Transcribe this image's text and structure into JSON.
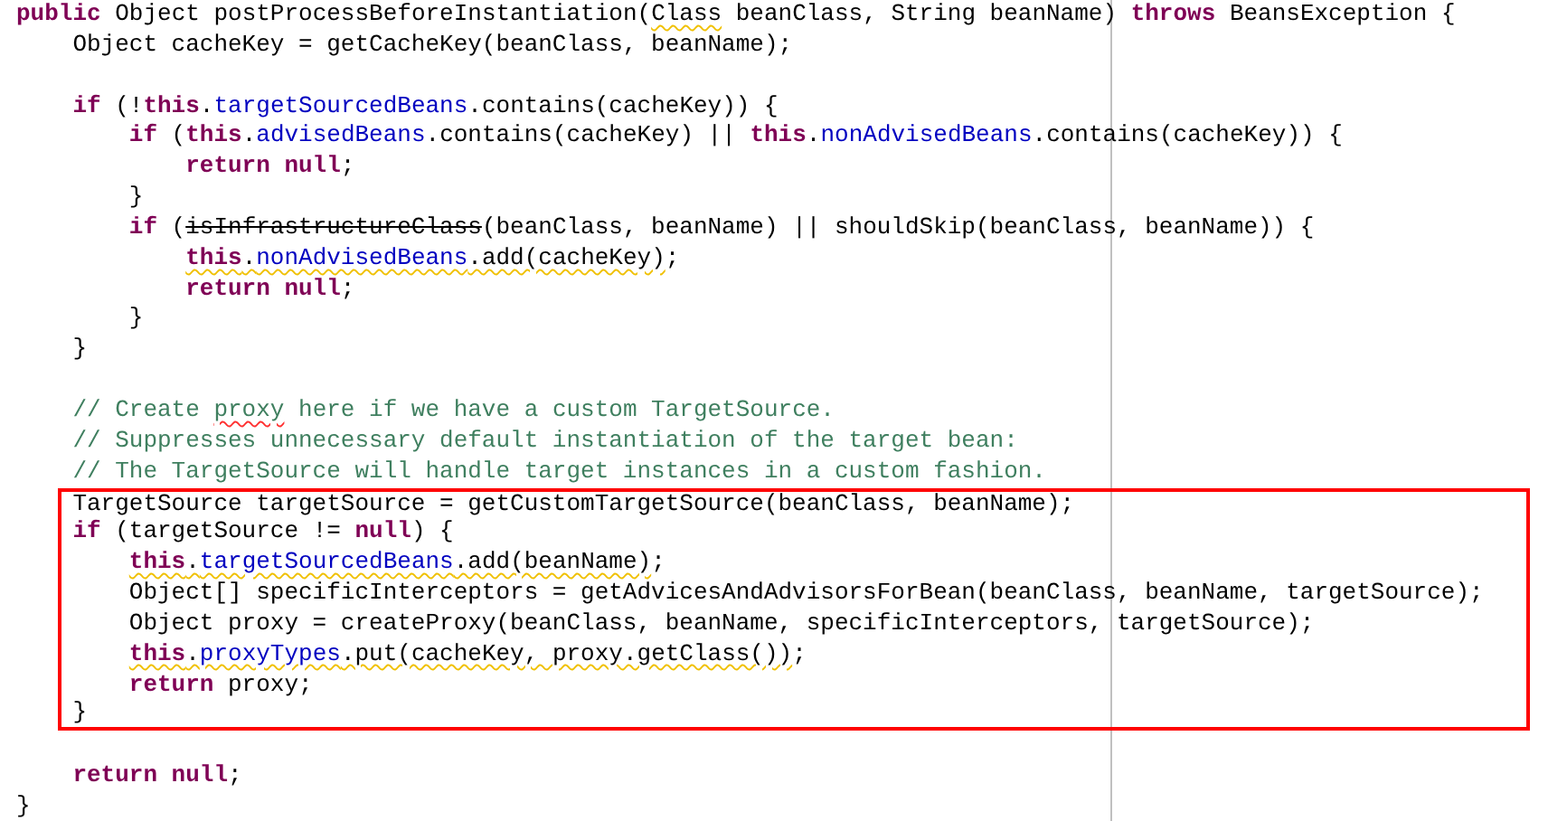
{
  "editor": {
    "lines": [
      {
        "highlighted": false,
        "segments": [
          {
            "text": "public",
            "kind": "keyword"
          },
          {
            "text": " Object postProcessBeforeInstantiation(",
            "kind": "plain"
          },
          {
            "text": "Class",
            "kind": "plain",
            "warning": true
          },
          {
            "text": " beanClass, String beanName) ",
            "kind": "plain"
          },
          {
            "text": "throws",
            "kind": "keyword"
          },
          {
            "text": " BeansException {",
            "kind": "plain"
          }
        ],
        "children": [
          {
            "highlighted": false,
            "segments": [
              {
                "text": "Object cacheKey = getCacheKey(beanClass, beanName);",
                "kind": "plain"
              }
            ]
          },
          {
            "highlighted": false
          },
          {
            "highlighted": false,
            "segments": [
              {
                "text": "if",
                "kind": "keyword"
              },
              {
                "text": " (!",
                "kind": "plain"
              },
              {
                "text": "this",
                "kind": "keyword"
              },
              {
                "text": ".",
                "kind": "plain"
              },
              {
                "text": "targetSourcedBeans",
                "kind": "field"
              },
              {
                "text": ".contains(cacheKey)) {",
                "kind": "plain"
              }
            ],
            "children": [
              {
                "highlighted": false,
                "segments": [
                  {
                    "text": "if",
                    "kind": "keyword"
                  },
                  {
                    "text": " (",
                    "kind": "plain"
                  },
                  {
                    "text": "this",
                    "kind": "keyword"
                  },
                  {
                    "text": ".",
                    "kind": "plain"
                  },
                  {
                    "text": "advisedBeans",
                    "kind": "field"
                  },
                  {
                    "text": ".contains(cacheKey) || ",
                    "kind": "plain"
                  },
                  {
                    "text": "this",
                    "kind": "keyword"
                  },
                  {
                    "text": ".",
                    "kind": "plain"
                  },
                  {
                    "text": "nonAdvisedBeans",
                    "kind": "field"
                  },
                  {
                    "text": ".contains(cacheKey)) {",
                    "kind": "plain"
                  }
                ],
                "children": [
                  {
                    "highlighted": false,
                    "segments": [
                      {
                        "text": "return null",
                        "kind": "keyword"
                      },
                      {
                        "text": ";",
                        "kind": "plain"
                      }
                    ]
                  }
                ]
              },
              {
                "highlighted": false,
                "segments": [
                  {
                    "text": "}",
                    "kind": "plain"
                  }
                ]
              },
              {
                "highlighted": false,
                "segments": [
                  {
                    "text": "if",
                    "kind": "keyword"
                  },
                  {
                    "text": " (",
                    "kind": "plain"
                  },
                  {
                    "text": "isInfrastructureClass",
                    "kind": "plain",
                    "deprecated": true
                  },
                  {
                    "text": "(beanClass, beanName) || shouldSkip(beanClass, beanName)) {",
                    "kind": "plain"
                  }
                ],
                "children": [
                  {
                    "highlighted": false,
                    "segments": [
                      {
                        "text": "this",
                        "kind": "keyword",
                        "warning": true
                      },
                      {
                        "text": ".",
                        "kind": "plain",
                        "warning": true
                      },
                      {
                        "text": "nonAdvisedBeans",
                        "kind": "field",
                        "warning": true
                      },
                      {
                        "text": ".add(cacheKey)",
                        "kind": "plain",
                        "warning": true
                      },
                      {
                        "text": ";",
                        "kind": "plain"
                      }
                    ]
                  },
                  {
                    "highlighted": false,
                    "segments": [
                      {
                        "text": "return null",
                        "kind": "keyword"
                      },
                      {
                        "text": ";",
                        "kind": "plain"
                      }
                    ]
                  }
                ]
              },
              {
                "highlighted": false,
                "segments": [
                  {
                    "text": "}",
                    "kind": "plain"
                  }
                ]
              }
            ]
          },
          {
            "highlighted": false,
            "segments": [
              {
                "text": "}",
                "kind": "plain"
              }
            ]
          },
          {
            "highlighted": false
          },
          {
            "highlighted": false,
            "segments": [
              {
                "text": "// Create ",
                "kind": "comment"
              },
              {
                "text": "proxy",
                "kind": "comment",
                "misspelled": true
              },
              {
                "text": " here if we have a custom TargetSource.",
                "kind": "comment"
              }
            ]
          },
          {
            "highlighted": false,
            "segments": [
              {
                "text": "// Suppresses unnecessary default instantiation of the target bean:",
                "kind": "comment"
              }
            ]
          },
          {
            "highlighted": false,
            "segments": [
              {
                "text": "// The TargetSource will handle target instances in a custom fashion.",
                "kind": "comment"
              }
            ]
          },
          {
            "highlighted": true,
            "segments": [
              {
                "text": "TargetSource targetSource = getCustomTargetSource(beanClass, beanName);",
                "kind": "plain"
              }
            ]
          },
          {
            "highlighted": true,
            "segments": [
              {
                "text": "if",
                "kind": "keyword"
              },
              {
                "text": " (targetSource != ",
                "kind": "plain"
              },
              {
                "text": "null",
                "kind": "keyword"
              },
              {
                "text": ") {",
                "kind": "plain"
              }
            ],
            "children": [
              {
                "highlighted": true,
                "segments": [
                  {
                    "text": "this",
                    "kind": "keyword",
                    "warning": true
                  },
                  {
                    "text": ".",
                    "kind": "plain",
                    "warning": true
                  },
                  {
                    "text": "targetSourcedBeans",
                    "kind": "field",
                    "warning": true
                  },
                  {
                    "text": ".add(beanName)",
                    "kind": "plain",
                    "warning": true
                  },
                  {
                    "text": ";",
                    "kind": "plain"
                  }
                ]
              },
              {
                "highlighted": true,
                "segments": [
                  {
                    "text": "Object[] specificInterceptors = getAdvicesAndAdvisorsForBean(beanClass, beanName, targetSource);",
                    "kind": "plain"
                  }
                ]
              },
              {
                "highlighted": true,
                "segments": [
                  {
                    "text": "Object proxy = createProxy(beanClass, beanName, specificInterceptors, targetSource);",
                    "kind": "plain"
                  }
                ]
              },
              {
                "highlighted": true,
                "segments": [
                  {
                    "text": "this",
                    "kind": "keyword",
                    "warning": true
                  },
                  {
                    "text": ".",
                    "kind": "plain",
                    "warning": true
                  },
                  {
                    "text": "proxyTypes",
                    "kind": "field",
                    "warning": true
                  },
                  {
                    "text": ".put(cacheKey, proxy.getClass())",
                    "kind": "plain",
                    "warning": true
                  },
                  {
                    "text": ";",
                    "kind": "plain"
                  }
                ]
              },
              {
                "highlighted": true,
                "segments": [
                  {
                    "text": "return",
                    "kind": "keyword"
                  },
                  {
                    "text": " proxy;",
                    "kind": "plain"
                  }
                ]
              }
            ]
          },
          {
            "highlighted": true,
            "segments": [
              {
                "text": "}",
                "kind": "plain"
              }
            ]
          },
          {
            "highlighted": false
          },
          {
            "highlighted": false,
            "segments": [
              {
                "text": "return null",
                "kind": "keyword"
              },
              {
                "text": ";",
                "kind": "plain"
              }
            ]
          }
        ]
      },
      {
        "highlighted": false,
        "segments": [
          {
            "text": "}",
            "kind": "plain"
          }
        ]
      }
    ]
  }
}
